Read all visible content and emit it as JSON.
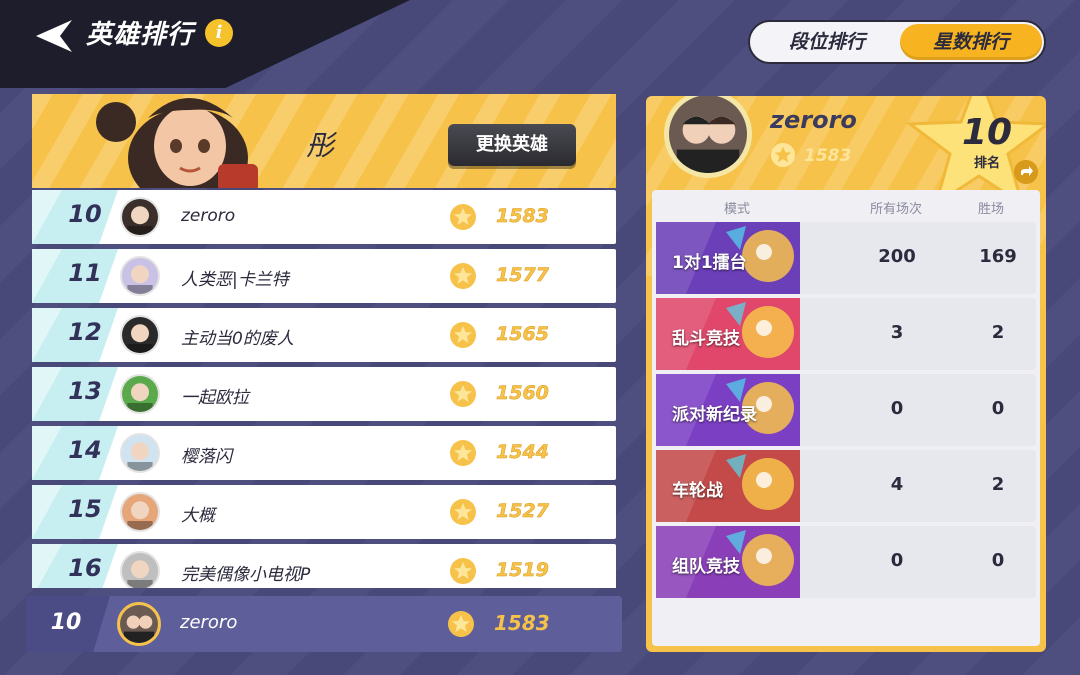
{
  "header": {
    "title": "英雄排行"
  },
  "toggle": {
    "left_label": "段位排行",
    "right_label": "星数排行",
    "active": "星数排行"
  },
  "hero": {
    "name": "彤",
    "change_button": "更换英雄"
  },
  "leaderboard": [
    {
      "rank": "10",
      "name": "zeroro",
      "score": "1583",
      "avatar_color": "#3a2f2a"
    },
    {
      "rank": "11",
      "name": "人类恶|卡兰特",
      "score": "1577",
      "avatar_color": "#c9c2e6"
    },
    {
      "rank": "12",
      "name": "主动当0的废人",
      "score": "1565",
      "avatar_color": "#2a2a2a"
    },
    {
      "rank": "13",
      "name": "一起欧拉",
      "score": "1560",
      "avatar_color": "#5aa94a"
    },
    {
      "rank": "14",
      "name": "樱落闪",
      "score": "1544",
      "avatar_color": "#cfe3f0"
    },
    {
      "rank": "15",
      "name": "大概",
      "score": "1527",
      "avatar_color": "#e7a57a"
    },
    {
      "rank": "16",
      "name": "完美偶像小电视P",
      "score": "1519",
      "avatar_color": "#bfbfbf"
    }
  ],
  "self": {
    "rank": "10",
    "name": "zeroro",
    "score": "1583"
  },
  "profile": {
    "name": "zeroro",
    "score": "1583",
    "rank": "10",
    "rank_label": "排名"
  },
  "stats": {
    "headers": {
      "mode": "模式",
      "total": "所有场次",
      "wins": "胜场"
    },
    "modes": [
      {
        "name": "1对1擂台",
        "total": "200",
        "wins": "169",
        "color": "#6b3fb8"
      },
      {
        "name": "乱斗竞技",
        "total": "3",
        "wins": "2",
        "color": "#e0476a"
      },
      {
        "name": "派对新纪录",
        "total": "0",
        "wins": "0",
        "color": "#7b3fc4"
      },
      {
        "name": "车轮战",
        "total": "4",
        "wins": "2",
        "color": "#c44a4a"
      },
      {
        "name": "组队竞技",
        "total": "0",
        "wins": "0",
        "color": "#8a3fb8"
      }
    ]
  },
  "colors": {
    "accent": "#f7c24a",
    "panel_dark": "#5e5e9a",
    "rank_tint": "#c7eef0"
  }
}
